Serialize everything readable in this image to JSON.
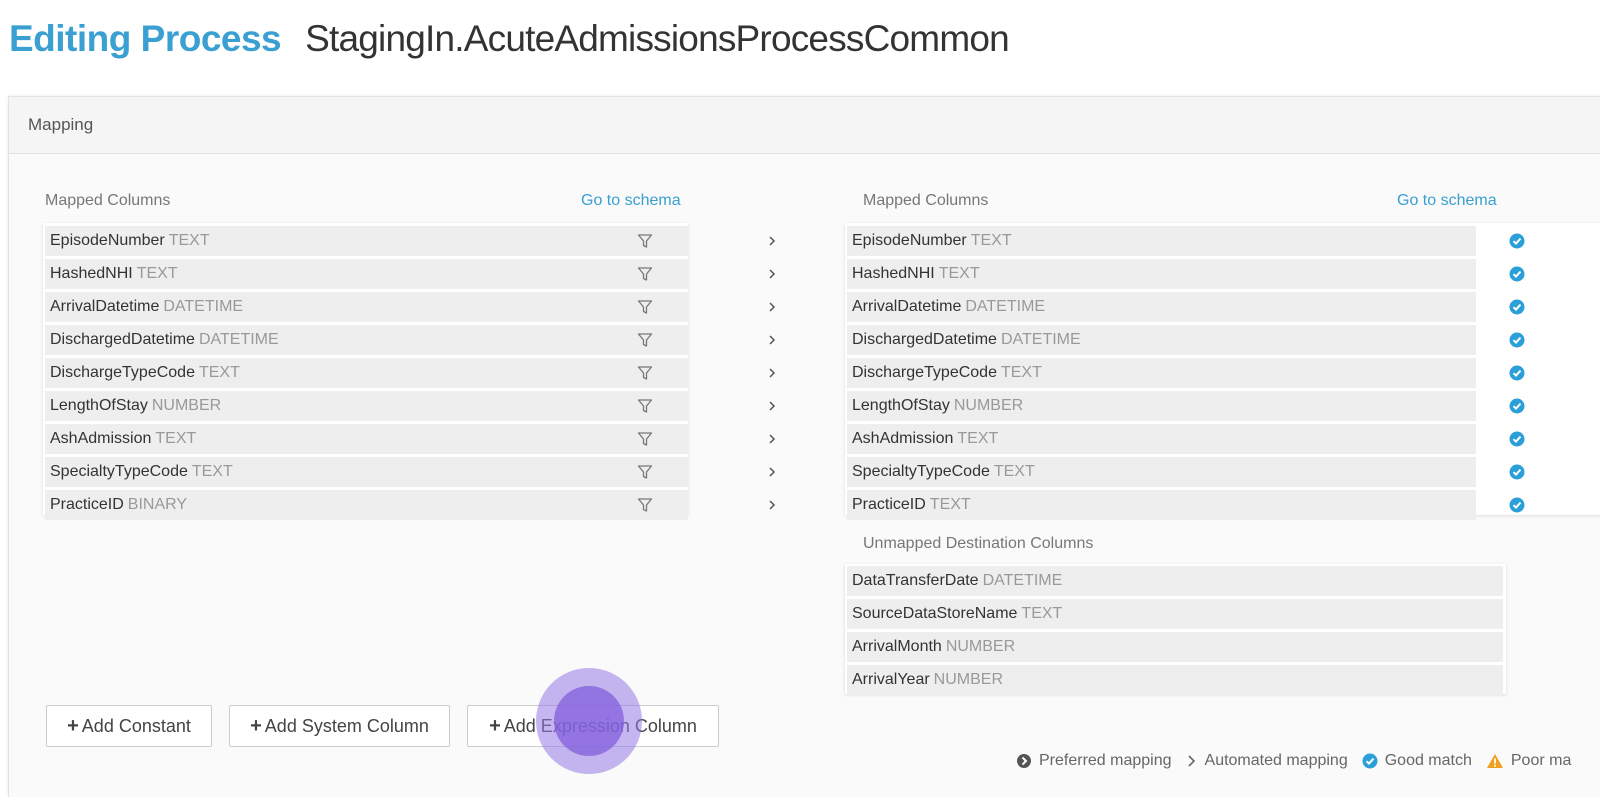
{
  "header": {
    "title": "Editing Process",
    "process_name": "StagingIn.AcuteAdmissionsProcessCommon"
  },
  "panel": {
    "heading": "Mapping"
  },
  "source": {
    "label": "Mapped Columns",
    "schema_link": "Go to schema",
    "columns": [
      {
        "name": "EpisodeNumber",
        "type": "TEXT"
      },
      {
        "name": "HashedNHI",
        "type": "TEXT"
      },
      {
        "name": "ArrivalDatetime",
        "type": "DATETIME"
      },
      {
        "name": "DischargedDatetime",
        "type": "DATETIME"
      },
      {
        "name": "DischargeTypeCode",
        "type": "TEXT"
      },
      {
        "name": "LengthOfStay",
        "type": "NUMBER"
      },
      {
        "name": "AshAdmission",
        "type": "TEXT"
      },
      {
        "name": "SpecialtyTypeCode",
        "type": "TEXT"
      },
      {
        "name": "PracticeID",
        "type": "BINARY"
      }
    ]
  },
  "destination": {
    "label": "Mapped Columns",
    "schema_link": "Go to schema",
    "columns": [
      {
        "name": "EpisodeNumber",
        "type": "TEXT"
      },
      {
        "name": "HashedNHI",
        "type": "TEXT"
      },
      {
        "name": "ArrivalDatetime",
        "type": "DATETIME"
      },
      {
        "name": "DischargedDatetime",
        "type": "DATETIME"
      },
      {
        "name": "DischargeTypeCode",
        "type": "TEXT"
      },
      {
        "name": "LengthOfStay",
        "type": "NUMBER"
      },
      {
        "name": "AshAdmission",
        "type": "TEXT"
      },
      {
        "name": "SpecialtyTypeCode",
        "type": "TEXT"
      },
      {
        "name": "PracticeID",
        "type": "TEXT"
      }
    ]
  },
  "unmapped": {
    "label": "Unmapped Destination Columns",
    "columns": [
      {
        "name": "DataTransferDate",
        "type": "DATETIME"
      },
      {
        "name": "SourceDataStoreName",
        "type": "TEXT"
      },
      {
        "name": "ArrivalMonth",
        "type": "NUMBER"
      },
      {
        "name": "ArrivalYear",
        "type": "NUMBER"
      }
    ]
  },
  "buttons": {
    "add_constant": "Add Constant",
    "add_system_column": "Add System Column",
    "add_expression_column": "Add Expression Column"
  },
  "legend": {
    "preferred": "Preferred mapping",
    "automated": "Automated mapping",
    "good": "Good match",
    "poor": "Poor ma"
  },
  "colors": {
    "accent": "#3a9fd1",
    "good_match": "#2a9fd8",
    "poor_match": "#f0a020"
  }
}
